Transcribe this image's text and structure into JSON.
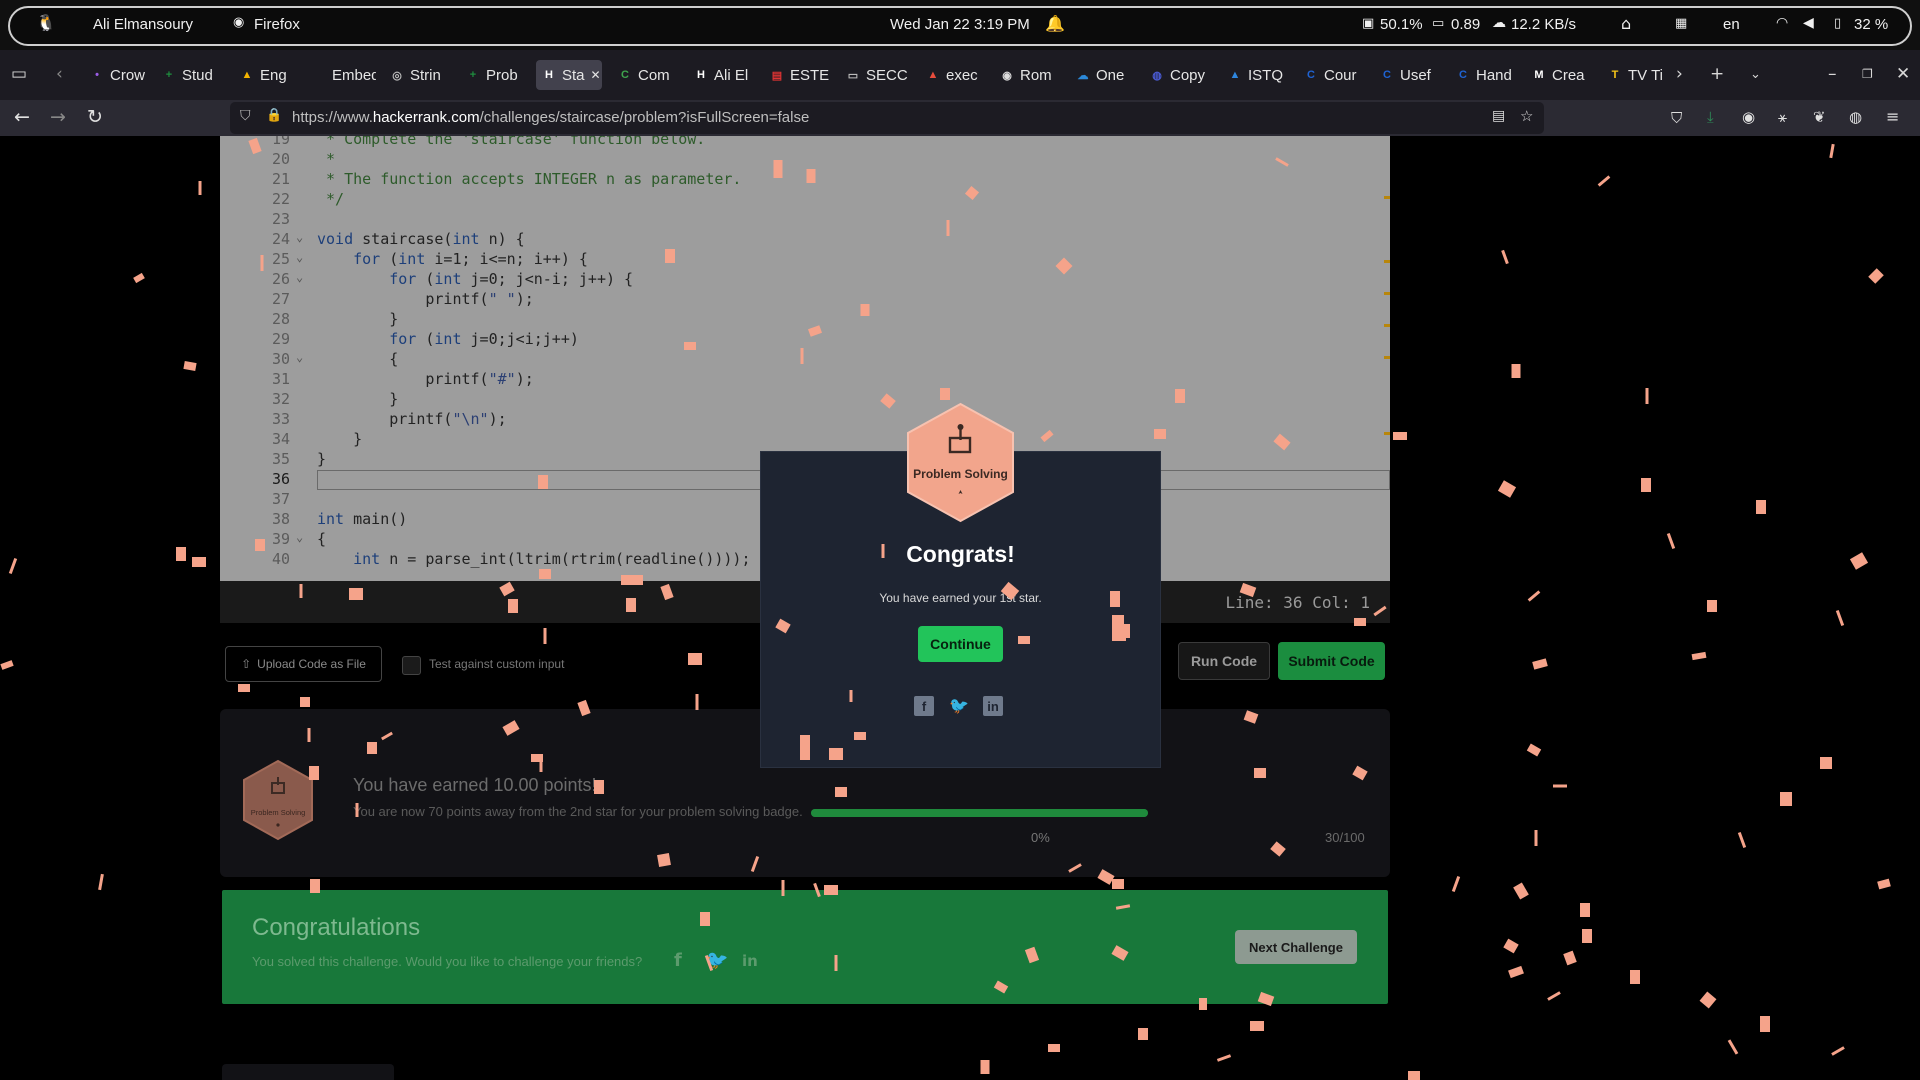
{
  "system_bar": {
    "user": "Ali Elmansoury",
    "app": "Firefox",
    "clock": "Wed Jan 22  3:19 PM",
    "cpu": "50.1%",
    "load": "0.89",
    "net": "12.2 KB/s",
    "lang": "en",
    "battery": "32 %"
  },
  "tabs": [
    {
      "label": "Crow",
      "fav": "•",
      "color": "#9b5de5"
    },
    {
      "label": "Stud",
      "fav": "+",
      "color": "#1e8e3e"
    },
    {
      "label": "Eng",
      "fav": "▲",
      "color": "#f4b400"
    },
    {
      "label": "Embedd",
      "fav": "",
      "color": "#1c1b22"
    },
    {
      "label": "Strin",
      "fav": "◎",
      "color": "#bbbbbb"
    },
    {
      "label": "Prob",
      "fav": "+",
      "color": "#1e8e3e"
    },
    {
      "label": "Sta",
      "fav": "H",
      "color": "#ffffff",
      "active": true
    },
    {
      "label": "Com",
      "fav": "C",
      "color": "#3fa34d"
    },
    {
      "label": "Ali El",
      "fav": "H",
      "color": "#ffffff"
    },
    {
      "label": "ESTE",
      "fav": "▤",
      "color": "#d33"
    },
    {
      "label": "SECC",
      "fav": "▭",
      "color": "#bbbbbb"
    },
    {
      "label": "exec",
      "fav": "▲",
      "color": "#e74c3c"
    },
    {
      "label": "Rom",
      "fav": "◉",
      "color": "#dddddd"
    },
    {
      "label": "One",
      "fav": "☁",
      "color": "#2b88d8"
    },
    {
      "label": "Copy",
      "fav": "◍",
      "color": "#4a5bd4"
    },
    {
      "label": "ISTQ",
      "fav": "▲",
      "color": "#2e86de"
    },
    {
      "label": "Cour",
      "fav": "C",
      "color": "#1f63d3"
    },
    {
      "label": "Usef",
      "fav": "C",
      "color": "#1f63d3"
    },
    {
      "label": "Hand",
      "fav": "C",
      "color": "#1f63d3"
    },
    {
      "label": "Crea",
      "fav": "M",
      "color": "#ffffff"
    },
    {
      "label": "TV Ti",
      "fav": "T",
      "color": "#f5c518"
    }
  ],
  "url": {
    "prefix": "https://www.",
    "domain": "hackerrank.com",
    "path": "/challenges/staircase/problem?isFullScreen=false"
  },
  "editor": {
    "lines": [
      {
        "n": "19",
        "html": "<span class='com'> * Complete the 'staircase' function below.</span>"
      },
      {
        "n": "20",
        "html": "<span class='com'> *</span>"
      },
      {
        "n": "21",
        "html": "<span class='com'> * The function accepts INTEGER n as parameter.</span>"
      },
      {
        "n": "22",
        "html": "<span class='com'> */</span>"
      },
      {
        "n": "23",
        "html": ""
      },
      {
        "n": "24",
        "fold": true,
        "html": "<span class='kw'>void</span> staircase(<span class='kw'>int</span> n) {"
      },
      {
        "n": "25",
        "fold": true,
        "html": "    <span class='kw'>for</span> (<span class='kw'>int</span> i=1; i&lt;=n; i++) {"
      },
      {
        "n": "26",
        "fold": true,
        "html": "        <span class='kw'>for</span> (<span class='kw'>int</span> j=0; j&lt;n-i; j++) {"
      },
      {
        "n": "27",
        "html": "            printf(<span class='str'>\" \"</span>);"
      },
      {
        "n": "28",
        "html": "        }"
      },
      {
        "n": "29",
        "html": "        <span class='kw'>for</span> (<span class='kw'>int</span> j=0;j&lt;i;j++)"
      },
      {
        "n": "30",
        "fold": true,
        "html": "        {"
      },
      {
        "n": "31",
        "html": "            printf(<span class='str'>\"#\"</span>);"
      },
      {
        "n": "32",
        "html": "        }"
      },
      {
        "n": "33",
        "html": "        printf(<span class='str'>\"\\n\"</span>);"
      },
      {
        "n": "34",
        "html": "    }"
      },
      {
        "n": "35",
        "html": "}"
      },
      {
        "n": "36",
        "current": true,
        "html": ""
      },
      {
        "n": "37",
        "html": ""
      },
      {
        "n": "38",
        "html": "<span class='kw'>int</span> main()"
      },
      {
        "n": "39",
        "fold": true,
        "html": "{"
      },
      {
        "n": "40",
        "html": "    <span class='kw'>int</span> n = parse_int(ltrim(rtrim(readline())));"
      }
    ],
    "status": "Line: 36 Col: 1"
  },
  "actions": {
    "upload": "Upload Code as File",
    "custom_input": "Test against custom input",
    "run": "Run Code",
    "submit": "Submit Code"
  },
  "points": {
    "badge_label": "Problem Solving",
    "title": "You have earned 10.00 points!",
    "subtitle": "You are now 70 points away from the 2nd star for your problem solving badge.",
    "progress_min": "0%",
    "progress_max": "30/100",
    "progress_value": 1.0
  },
  "banner": {
    "title": "Congratulations",
    "subtitle": "You solved this challenge. Would you like to challenge your friends?",
    "next": "Next Challenge"
  },
  "modal": {
    "badge_label": "Problem Solving",
    "title": "Congrats!",
    "subtitle": "You have earned your 1st star.",
    "continue": "Continue"
  },
  "colors": {
    "accent_green": "#22c45a",
    "confetti": "#f5a38a",
    "badge": "#f2a58c"
  },
  "icons": [
    "linux-icon",
    "firefox-icon",
    "bell-icon",
    "home-icon",
    "wifi-icon",
    "volume-icon",
    "battery-icon",
    "facebook-icon",
    "twitter-icon",
    "linkedin-icon"
  ]
}
